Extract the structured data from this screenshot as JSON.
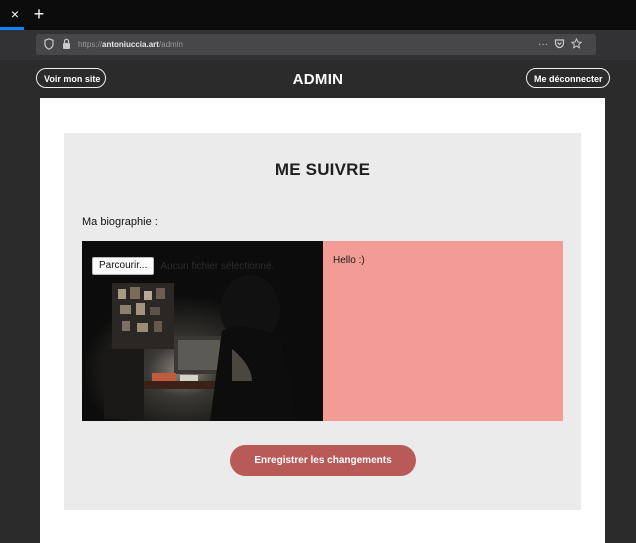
{
  "browser": {
    "tab_close_symbol": "×",
    "tab_new_symbol": "+",
    "url_prefix": "https://",
    "url_domain": "antoniuccia.art",
    "url_path": "/admin",
    "url_menu_symbol": "···",
    "icons": [
      "shield-icon",
      "lock-icon",
      "pocket-icon",
      "star-icon"
    ]
  },
  "header": {
    "left_button": "Voir mon site",
    "title": "ADMIN",
    "right_button": "Me déconnecter"
  },
  "panel": {
    "title": "ME SUIVRE",
    "bio_label": "Ma biographie :",
    "file_button": "Parcourir...",
    "file_status": "Aucun fichier sélectionné.",
    "bio_text": "Hello :)",
    "save_button": "Enregistrer les changements"
  },
  "colors": {
    "page_bg": "#2b2b2b",
    "panel_bg": "#ebebeb",
    "bio_bg": "#f29c95",
    "save_button": "#b85b58"
  }
}
